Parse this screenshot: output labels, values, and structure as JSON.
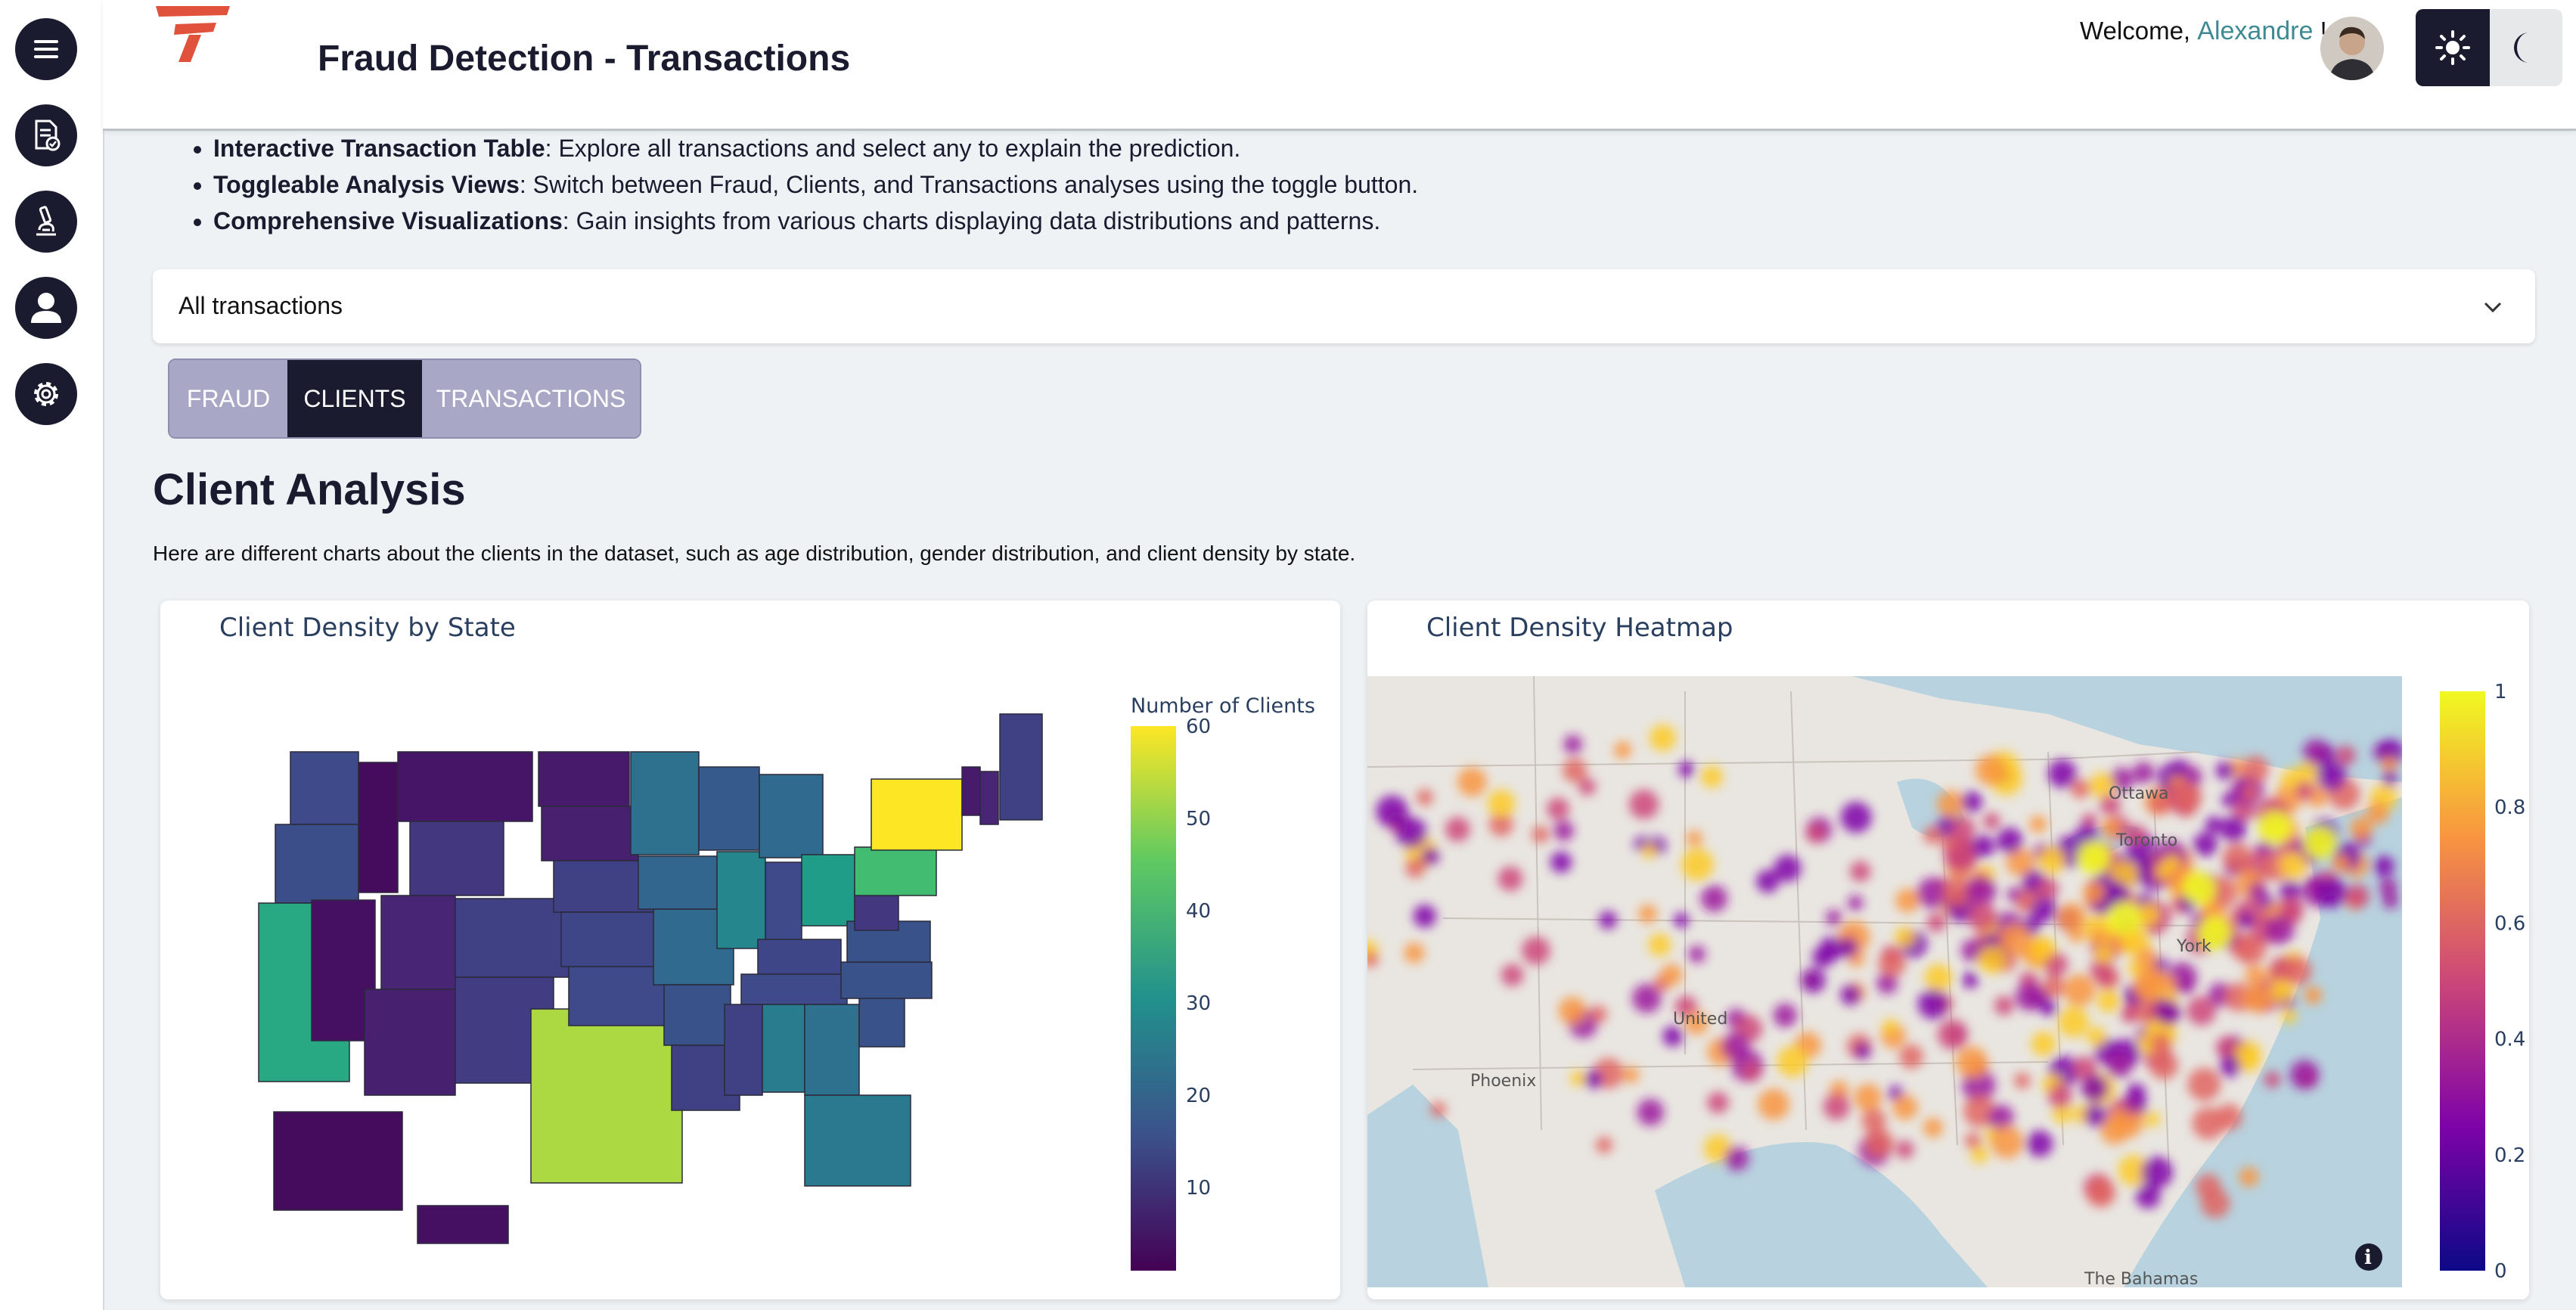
{
  "app": {
    "title": "Fraud Detection - Transactions",
    "welcome_prefix": "Welcome, ",
    "user_name": "Alexandre",
    "welcome_suffix": " !"
  },
  "sidebar": {
    "items": [
      {
        "name": "menu-icon"
      },
      {
        "name": "document-check-icon"
      },
      {
        "name": "microscope-icon"
      },
      {
        "name": "user-icon"
      },
      {
        "name": "settings-icon"
      }
    ]
  },
  "theme": {
    "light_icon": "sun-icon",
    "dark_icon": "moon-icon"
  },
  "features": [
    {
      "bold": "Interactive Transaction Table",
      "text": ": Explore all transactions and select any to explain the prediction."
    },
    {
      "bold": "Toggleable Analysis Views",
      "text": ": Switch between Fraud, Clients, and Transactions analyses using the toggle button."
    },
    {
      "bold": "Comprehensive Visualizations",
      "text": ": Gain insights from various charts displaying data distributions and patterns."
    }
  ],
  "dropdown": {
    "label": "All transactions"
  },
  "toggle": {
    "options": [
      "FRAUD",
      "CLIENTS",
      "TRANSACTIONS"
    ],
    "selected": "CLIENTS"
  },
  "section": {
    "title": "Client Analysis",
    "description": "Here are different charts about the clients in the dataset, such as age distribution, gender distribution, and client density by state."
  },
  "colors": {
    "accent": "#1b1b2f",
    "toggle_inactive": "#a9a7c6",
    "user_link": "#3f8a92",
    "logo": "#e0523b"
  },
  "chart_data": [
    {
      "type": "choropleth",
      "title": "Client Density by State",
      "colorbar_title": "Number of Clients",
      "colorbar_ticks": [
        10,
        20,
        30,
        40,
        50,
        60
      ],
      "colorscale": "Viridis",
      "states": [
        {
          "state": "WA",
          "value": 16
        },
        {
          "state": "OR",
          "value": 17
        },
        {
          "state": "CA",
          "value": 41
        },
        {
          "state": "NV",
          "value": 4
        },
        {
          "state": "ID",
          "value": 3
        },
        {
          "state": "MT",
          "value": 5
        },
        {
          "state": "WY",
          "value": 12
        },
        {
          "state": "UT",
          "value": 8
        },
        {
          "state": "AZ",
          "value": 7
        },
        {
          "state": "CO",
          "value": 14
        },
        {
          "state": "NM",
          "value": 13
        },
        {
          "state": "TX",
          "value": 56
        },
        {
          "state": "ND",
          "value": 6
        },
        {
          "state": "SD",
          "value": 7
        },
        {
          "state": "NE",
          "value": 14
        },
        {
          "state": "KS",
          "value": 15
        },
        {
          "state": "OK",
          "value": 16
        },
        {
          "state": "MN",
          "value": 26
        },
        {
          "state": "IA",
          "value": 23
        },
        {
          "state": "MO",
          "value": 24
        },
        {
          "state": "AR",
          "value": 18
        },
        {
          "state": "LA",
          "value": 14
        },
        {
          "state": "WI",
          "value": 20
        },
        {
          "state": "IL",
          "value": 32
        },
        {
          "state": "MI",
          "value": 24
        },
        {
          "state": "IN",
          "value": 16
        },
        {
          "state": "OH",
          "value": 38
        },
        {
          "state": "KY",
          "value": 15
        },
        {
          "state": "TN",
          "value": 16
        },
        {
          "state": "MS",
          "value": 14
        },
        {
          "state": "AL",
          "value": 29
        },
        {
          "state": "GA",
          "value": 26
        },
        {
          "state": "FL",
          "value": 28
        },
        {
          "state": "SC",
          "value": 18
        },
        {
          "state": "NC",
          "value": 18
        },
        {
          "state": "VA",
          "value": 18
        },
        {
          "state": "WV",
          "value": 12
        },
        {
          "state": "PA",
          "value": 47
        },
        {
          "state": "NY",
          "value": 60
        },
        {
          "state": "ME",
          "value": 14
        },
        {
          "state": "VT",
          "value": 6
        },
        {
          "state": "NH",
          "value": 8
        },
        {
          "state": "AK",
          "value": 3
        },
        {
          "state": "HI",
          "value": 4
        }
      ]
    },
    {
      "type": "heatmap",
      "title": "Client Density Heatmap",
      "colorbar_ticks": [
        0,
        0.2,
        0.4,
        0.6,
        0.8,
        1
      ],
      "colorscale": "Plasma",
      "map_labels": [
        "Ottawa",
        "Toronto",
        "United",
        "Phoenix",
        "The Bahamas",
        "York"
      ]
    }
  ]
}
